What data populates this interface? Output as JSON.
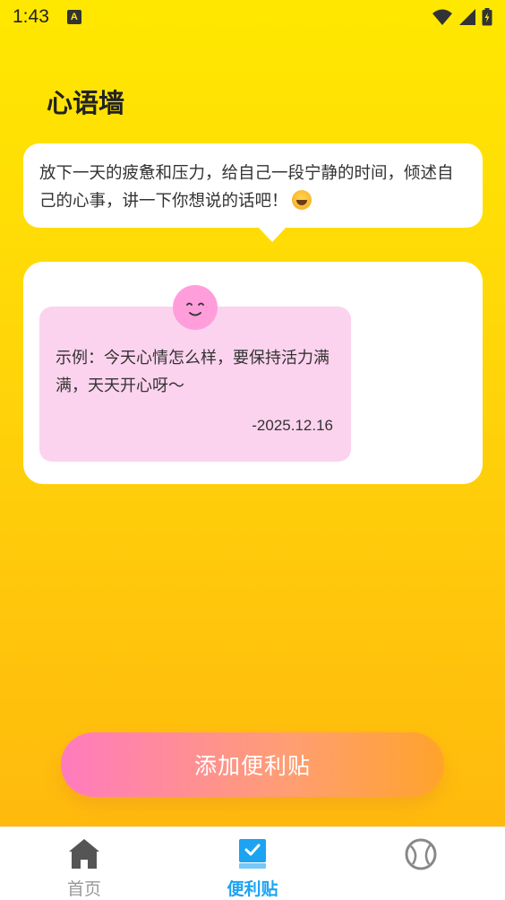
{
  "status_bar": {
    "time": "1:43",
    "notification_icon": "a-icon",
    "icons": [
      "wifi-icon",
      "signal-icon",
      "battery-icon"
    ]
  },
  "page": {
    "title": "心语墙"
  },
  "intro": {
    "text": "放下一天的疲惫和压力，给自己一段宁静的时间，倾述自己的心事，讲一下你想说的话吧！",
    "emoji_icon": "grinning-face-icon"
  },
  "note": {
    "text": "示例：今天心情怎么样，要保持活力满满，天天开心呀～",
    "date": "-2025.12.16",
    "avatar_icon": "smiling-face-icon",
    "color": "#FCD3EE",
    "avatar_color": "#FF9EDB"
  },
  "actions": {
    "add_label": "添加便利贴"
  },
  "tab_bar": {
    "tabs": [
      {
        "label": "首页",
        "icon": "home-icon",
        "active": false
      },
      {
        "label": "便利贴",
        "icon": "sticky-note-icon",
        "active": true
      },
      {
        "label": "",
        "icon": "baseball-icon",
        "active": false
      }
    ],
    "active_color": "#1CA3F2"
  }
}
